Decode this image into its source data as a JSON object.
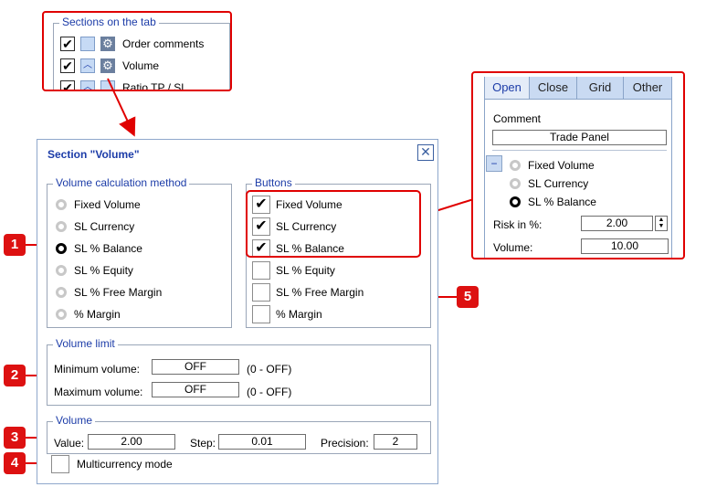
{
  "sections_panel": {
    "title": "Sections on the tab",
    "items": [
      {
        "label": "Order comments"
      },
      {
        "label": "Volume"
      },
      {
        "label": "Ratio TP / SL"
      }
    ]
  },
  "dialog": {
    "title": "Section \"Volume\"",
    "close_icon": "close-icon",
    "method": {
      "title": "Volume calculation method",
      "options": [
        "Fixed Volume",
        "SL Currency",
        "SL % Balance",
        "SL % Equity",
        "SL % Free Margin",
        "% Margin"
      ],
      "selected": "SL % Balance"
    },
    "buttons": {
      "title": "Buttons",
      "items": [
        {
          "label": "Fixed Volume",
          "checked": true
        },
        {
          "label": "SL Currency",
          "checked": true
        },
        {
          "label": "SL % Balance",
          "checked": true
        },
        {
          "label": "SL % Equity",
          "checked": false
        },
        {
          "label": "SL % Free Margin",
          "checked": false
        },
        {
          "label": "% Margin",
          "checked": false
        }
      ]
    },
    "limit": {
      "title": "Volume limit",
      "min_label": "Minimum volume:",
      "min_value": "OFF",
      "min_hint": "(0 - OFF)",
      "max_label": "Maximum volume:",
      "max_value": "OFF",
      "max_hint": "(0 - OFF)"
    },
    "volume": {
      "title": "Volume",
      "value_label": "Value:",
      "value": "2.00",
      "step_label": "Step:",
      "step": "0.01",
      "precision_label": "Precision:",
      "precision": "2"
    },
    "multicurrency": {
      "label": "Multicurrency mode",
      "checked": false
    }
  },
  "trade_panel": {
    "tabs": [
      "Open",
      "Close",
      "Grid",
      "Other"
    ],
    "active_tab": "Open",
    "comment_label": "Comment",
    "comment_value": "Trade Panel",
    "collapse_symbol": "−",
    "modes": [
      "Fixed Volume",
      "SL Currency",
      "SL % Balance"
    ],
    "selected_mode": "SL % Balance",
    "risk_label": "Risk in %:",
    "risk_value": "2.00",
    "volume_label": "Volume:",
    "volume_value": "10.00"
  },
  "markers": [
    "1",
    "2",
    "3",
    "4",
    "5"
  ],
  "colors": {
    "annotation_red": "#e00000",
    "legend_blue": "#1c3ca8",
    "tab_active_bg": "#e4ecf8"
  }
}
